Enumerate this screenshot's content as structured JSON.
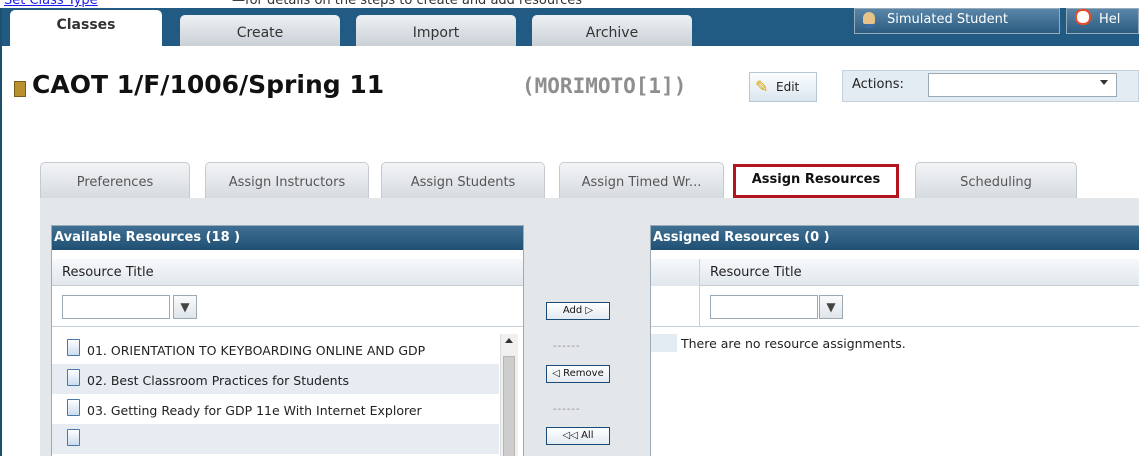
{
  "top_cutoff": {
    "link_text": "Set Class Type",
    "rest_text": "—for details on the steps to create and add resources"
  },
  "header": {
    "tabs": [
      {
        "label": "Classes",
        "active": true
      },
      {
        "label": "Create",
        "active": false
      },
      {
        "label": "Import",
        "active": false
      },
      {
        "label": "Archive",
        "active": false
      }
    ],
    "simulated_student_label": "Simulated Student",
    "help_label": "Hel"
  },
  "title": {
    "main": "CAOT 1/F/1006/Spring 11",
    "subtitle": "(MORIMOTO[1])",
    "edit_label": "Edit",
    "actions_label": "Actions:",
    "actions_value": ""
  },
  "subtabs": [
    {
      "label": "Preferences",
      "active": false
    },
    {
      "label": "Assign Instructors",
      "active": false
    },
    {
      "label": "Assign Students",
      "active": false
    },
    {
      "label": "Assign Timed Wr...",
      "active": false
    },
    {
      "label": "Assign Resources",
      "active": true
    },
    {
      "label": "Scheduling",
      "active": false
    }
  ],
  "available": {
    "header": "Available Resources  (18 )",
    "column": "Resource Title",
    "filter_value": "",
    "items": [
      "01. ORIENTATION TO KEYBOARDING ONLINE AND GDP",
      "02. Best Classroom Practices for Students",
      "03. Getting Ready for GDP 11e With Internet Explorer",
      ""
    ]
  },
  "transfer": {
    "add_label": "Add ▷",
    "remove_label": "◁ Remove",
    "all_label": "◁◁ All",
    "dashes": "------"
  },
  "assigned": {
    "header": "Assigned Resources  (0 )",
    "column": "Resource Title",
    "filter_value": "",
    "empty_message": "There are no resource assignments."
  },
  "colors": {
    "header_blue": "#215a83",
    "panel_head": "#2f6186",
    "highlight_red": "#b3141d"
  },
  "icons": {
    "filter": "funnel-icon",
    "book": "book-icon",
    "edit": "pencil-icon",
    "document": "document-icon",
    "user": "user-icon",
    "help": "lifebuoy-icon"
  }
}
